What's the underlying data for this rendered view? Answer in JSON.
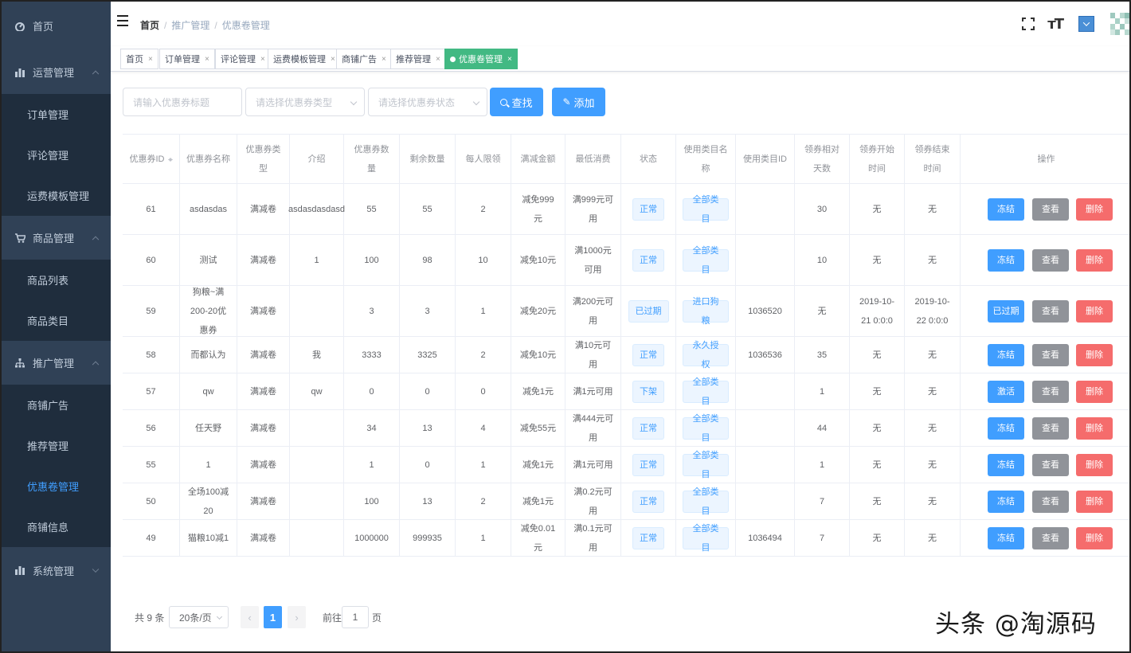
{
  "sidebar": {
    "home": "首页",
    "groups": [
      {
        "label": "运营管理",
        "icon": "bar-chart-icon",
        "items": [
          "订单管理",
          "评论管理",
          "运费模板管理"
        ]
      },
      {
        "label": "商品管理",
        "icon": "cart-icon",
        "items": [
          "商品列表",
          "商品类目"
        ]
      },
      {
        "label": "推广管理",
        "icon": "tree-icon",
        "items": [
          "商铺广告",
          "推荐管理",
          "优惠卷管理",
          "商铺信息"
        ]
      },
      {
        "label": "系统管理",
        "icon": "bar-chart-icon",
        "items": []
      }
    ],
    "active_item": "优惠卷管理"
  },
  "navbar": {
    "breadcrumb": [
      "首页",
      "推广管理",
      "优惠卷管理"
    ]
  },
  "tags": [
    "首页",
    "订单管理",
    "评论管理",
    "运费模板管理",
    "商铺广告",
    "推荐管理",
    "优惠卷管理"
  ],
  "filters": {
    "title_placeholder": "请输入优惠券标题",
    "type_placeholder": "请选择优惠券类型",
    "status_placeholder": "请选择优惠券状态",
    "search_label": "查找",
    "add_label": "添加"
  },
  "table": {
    "headers": [
      "优惠券ID",
      "优惠券名称",
      "优惠券类型",
      "介绍",
      "优惠券数量",
      "剩余数量",
      "每人限领",
      "满减金额",
      "最低消费",
      "状态",
      "使用类目名称",
      "使用类目ID",
      "领券相对天数",
      "领券开始时间",
      "领券结束时间",
      "操作"
    ],
    "rows": [
      {
        "id": "61",
        "name": "asdasdas",
        "type": "满减卷",
        "intro": "asdasdasdasd",
        "count": "55",
        "remain": "55",
        "limit": "2",
        "discount": "减免999元",
        "min": "满999元可用",
        "status": "正常",
        "cat_name": "全部类目",
        "cat_id": "",
        "days": "30",
        "start": "无",
        "end": "无",
        "action1": "冻结",
        "action2": "查看",
        "action3": "删除"
      },
      {
        "id": "60",
        "name": "测试",
        "type": "满减卷",
        "intro": "1",
        "count": "100",
        "remain": "98",
        "limit": "10",
        "discount": "减免10元",
        "min": "满1000元可用",
        "status": "正常",
        "cat_name": "全部类目",
        "cat_id": "",
        "days": "10",
        "start": "无",
        "end": "无",
        "action1": "冻结",
        "action2": "查看",
        "action3": "删除"
      },
      {
        "id": "59",
        "name": "狗粮~满200-20优惠券",
        "type": "满减卷",
        "intro": "",
        "count": "3",
        "remain": "3",
        "limit": "1",
        "discount": "减免20元",
        "min": "满200元可用",
        "status": "已过期",
        "cat_name": "进口狗粮",
        "cat_id": "1036520",
        "days": "无",
        "start": "2019-10-21 0:0:0",
        "end": "2019-10-22 0:0:0",
        "action1": "已过期",
        "action2": "查看",
        "action3": "删除"
      },
      {
        "id": "58",
        "name": "而都认为",
        "type": "满减卷",
        "intro": "我",
        "count": "3333",
        "remain": "3325",
        "limit": "2",
        "discount": "减免10元",
        "min": "满10元可用",
        "status": "正常",
        "cat_name": "永久授权",
        "cat_id": "1036536",
        "days": "35",
        "start": "无",
        "end": "无",
        "action1": "冻结",
        "action2": "查看",
        "action3": "删除"
      },
      {
        "id": "57",
        "name": "qw",
        "type": "满减卷",
        "intro": "qw",
        "count": "0",
        "remain": "0",
        "limit": "0",
        "discount": "减免1元",
        "min": "满1元可用",
        "status": "下架",
        "cat_name": "全部类目",
        "cat_id": "",
        "days": "1",
        "start": "无",
        "end": "无",
        "action1": "激活",
        "action2": "查看",
        "action3": "删除"
      },
      {
        "id": "56",
        "name": "任天野",
        "type": "满减卷",
        "intro": "",
        "count": "34",
        "remain": "13",
        "limit": "4",
        "discount": "减免55元",
        "min": "满444元可用",
        "status": "正常",
        "cat_name": "全部类目",
        "cat_id": "",
        "days": "44",
        "start": "无",
        "end": "无",
        "action1": "冻结",
        "action2": "查看",
        "action3": "删除"
      },
      {
        "id": "55",
        "name": "1",
        "type": "满减卷",
        "intro": "",
        "count": "1",
        "remain": "0",
        "limit": "1",
        "discount": "减免1元",
        "min": "满1元可用",
        "status": "正常",
        "cat_name": "全部类目",
        "cat_id": "",
        "days": "1",
        "start": "无",
        "end": "无",
        "action1": "冻结",
        "action2": "查看",
        "action3": "删除"
      },
      {
        "id": "50",
        "name": "全场100减20",
        "type": "满减卷",
        "intro": "",
        "count": "100",
        "remain": "13",
        "limit": "2",
        "discount": "减免1元",
        "min": "满0.2元可用",
        "status": "正常",
        "cat_name": "全部类目",
        "cat_id": "",
        "days": "7",
        "start": "无",
        "end": "无",
        "action1": "冻结",
        "action2": "查看",
        "action3": "删除"
      },
      {
        "id": "49",
        "name": "猫粮10减1",
        "type": "满减卷",
        "intro": "",
        "count": "1000000",
        "remain": "999935",
        "limit": "1",
        "discount": "减免0.01元",
        "min": "满0.1元可用",
        "status": "正常",
        "cat_name": "全部类目",
        "cat_id": "1036494",
        "days": "7",
        "start": "无",
        "end": "无",
        "action1": "冻结",
        "action2": "查看",
        "action3": "删除"
      }
    ]
  },
  "pagination": {
    "total": "共 9 条",
    "page_size": "20条/页",
    "current": "1",
    "goto_prefix": "前往",
    "goto_value": "1",
    "goto_suffix": "页"
  },
  "watermark": "头条 @淘源码",
  "colors": {
    "sidebar_bg": "#304156",
    "submenu_bg": "#1f2d3d",
    "primary": "#409eff",
    "success_tag": "#42b983",
    "danger": "#f56c6c",
    "info": "#909399"
  }
}
